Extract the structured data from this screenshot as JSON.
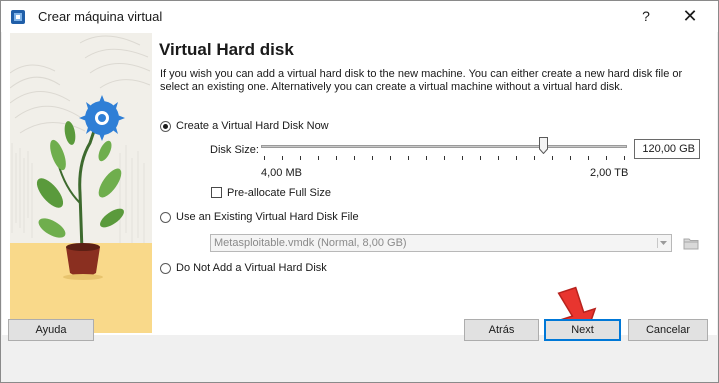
{
  "window": {
    "title": "Crear máquina virtual",
    "help_label": "?",
    "close_label": "✕"
  },
  "page": {
    "heading": "Virtual Hard disk",
    "description": "If you wish you can add a virtual hard disk to the new machine. You can either create a new hard disk file or select an existing one. Alternatively you can create a virtual machine without a virtual hard disk."
  },
  "options": {
    "create_label": "Create a Virtual Hard Disk Now",
    "existing_label": "Use an Existing Virtual Hard Disk File",
    "none_label": "Do Not Add a Virtual Hard Disk",
    "selected": "create"
  },
  "disk": {
    "size_label": "Disk Size:",
    "size_value": "120,00 GB",
    "min_label": "4,00 MB",
    "max_label": "2,00 TB",
    "slider_fraction": 0.77,
    "preallocate_label": "Pre-allocate Full Size",
    "preallocate_checked": false
  },
  "existing": {
    "selected_file": "Metasploitable.vmdk (Normal, 8,00 GB)"
  },
  "buttons": {
    "help": "Ayuda",
    "back": "Atrás",
    "next": "Next",
    "cancel": "Cancelar"
  },
  "colors": {
    "accent": "#0078d7",
    "arrow": "#e8352f",
    "flower": "#2f7fd6",
    "pot": "#8a2f20",
    "sand": "#f9d98a"
  },
  "icons": {
    "app": "virtualbox-icon",
    "folder": "folder-icon"
  }
}
